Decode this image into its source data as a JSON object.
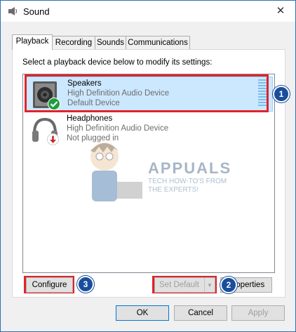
{
  "window": {
    "title": "Sound",
    "close_glyph": "✕"
  },
  "tabs": [
    {
      "label": "Playback",
      "active": true
    },
    {
      "label": "Recording",
      "active": false
    },
    {
      "label": "Sounds",
      "active": false
    },
    {
      "label": "Communications",
      "active": false
    }
  ],
  "instruction": "Select a playback device below to modify its settings:",
  "devices": [
    {
      "name": "Speakers",
      "description": "High Definition Audio Device",
      "status": "Default Device",
      "icon": "speaker-icon",
      "status_icon": "green-check-icon",
      "selected": true
    },
    {
      "name": "Headphones",
      "description": "High Definition Audio Device",
      "status": "Not plugged in",
      "icon": "headphones-icon",
      "status_icon": "red-down-arrow-icon",
      "selected": false
    }
  ],
  "watermark": {
    "title": "APPUALS",
    "line1": "TECH HOW-TO'S FROM",
    "line2": "THE EXPERTS!"
  },
  "buttons": {
    "configure": "Configure",
    "set_default": "Set Default",
    "set_default_arrow": "▼",
    "properties": "Properties",
    "ok": "OK",
    "cancel": "Cancel",
    "apply": "Apply"
  },
  "callouts": [
    "1",
    "2",
    "3"
  ],
  "colors": {
    "highlight": "#e0242b",
    "badge": "#1a4e9c",
    "selection": "#cce8ff"
  }
}
